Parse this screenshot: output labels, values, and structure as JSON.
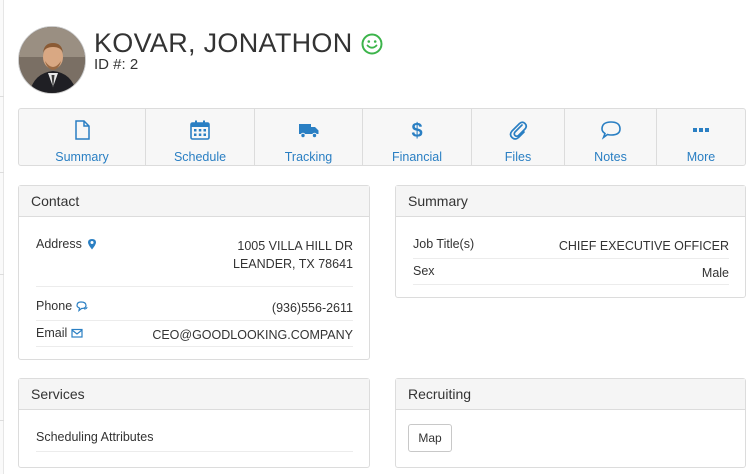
{
  "profile": {
    "name": "KOVAR, JONATHON",
    "id_line": "ID #: 2",
    "status_icon": "smile-icon",
    "status_color": "#3cb44b"
  },
  "tabs": [
    {
      "label": "Summary",
      "icon": "document-icon"
    },
    {
      "label": "Schedule",
      "icon": "calendar-icon"
    },
    {
      "label": "Tracking",
      "icon": "truck-icon"
    },
    {
      "label": "Financial",
      "icon": "dollar-icon"
    },
    {
      "label": "Files",
      "icon": "paperclip-icon"
    },
    {
      "label": "Notes",
      "icon": "speech-bubble-icon"
    },
    {
      "label": "More",
      "icon": "ellipsis-icon"
    }
  ],
  "contact": {
    "title": "Contact",
    "address_label": "Address",
    "address_line1": "1005 VILLA HILL DR",
    "address_line2": "LEANDER, TX 78641",
    "phone_label": "Phone",
    "phone_value": "(936)556-2611",
    "email_label": "Email",
    "email_value": "CEO@GOODLOOKING.COMPANY"
  },
  "summary": {
    "title": "Summary",
    "job_label": "Job Title(s)",
    "job_value": "CHIEF EXECUTIVE OFFICER",
    "sex_label": "Sex",
    "sex_value": "Male"
  },
  "services": {
    "title": "Services",
    "item": "Scheduling Attributes"
  },
  "recruiting": {
    "title": "Recruiting",
    "map_button": "Map"
  },
  "colors": {
    "accent": "#2a7fc3",
    "border": "#dcdcdc",
    "panel_header": "#f5f5f5"
  }
}
